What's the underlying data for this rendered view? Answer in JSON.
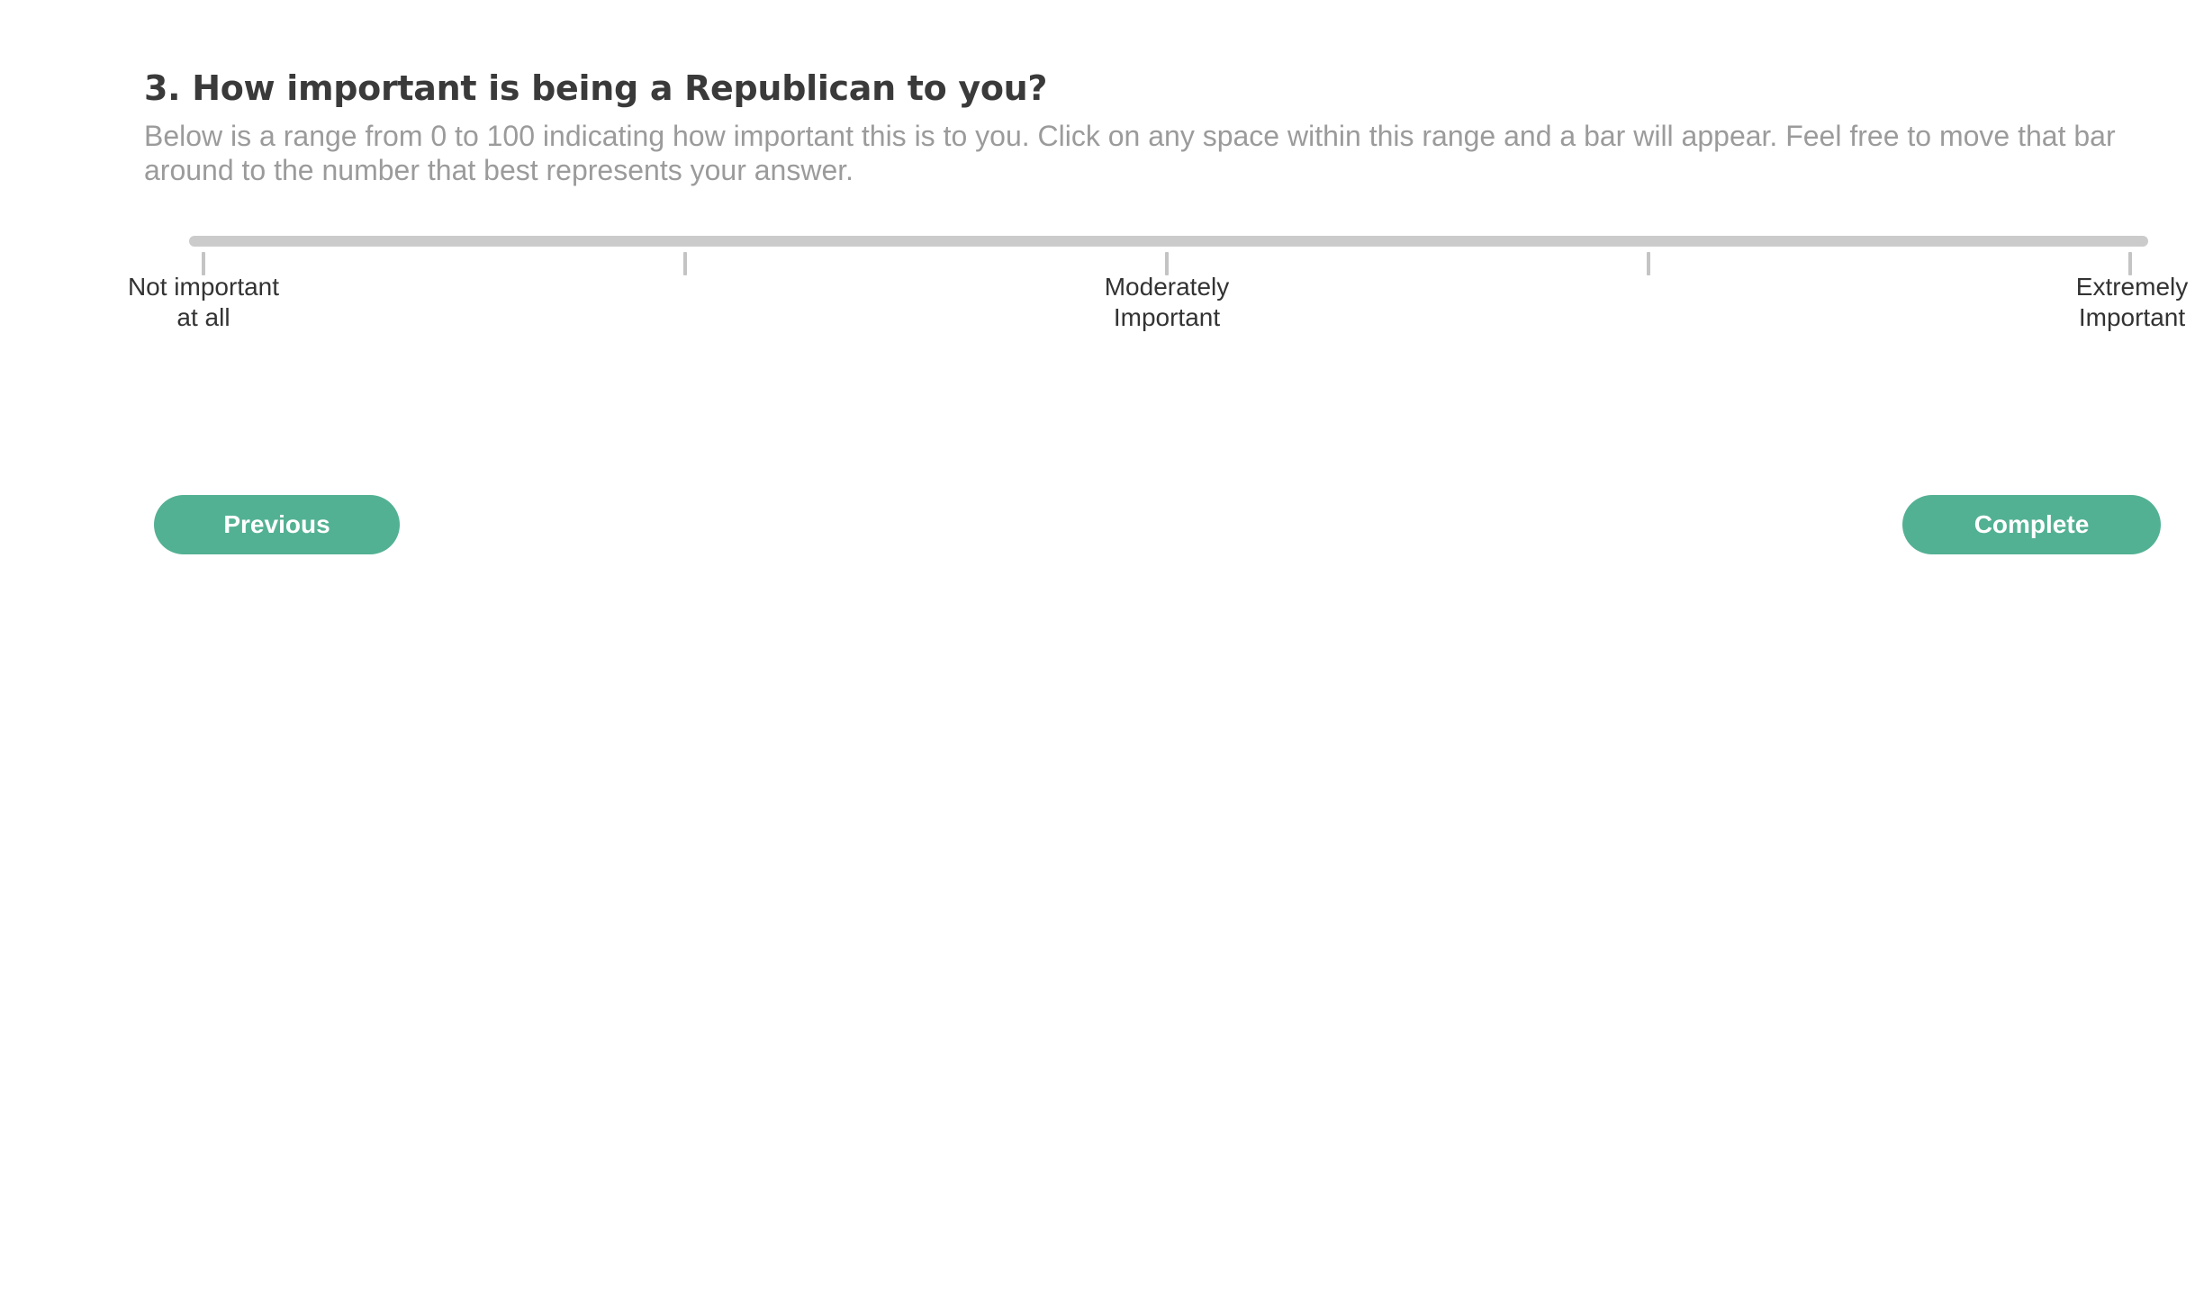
{
  "question": {
    "title": "3. How important is being a Republican to you?",
    "description": "Below is a range from 0 to 100 indicating how important this is to you. Click on any space within this range and a bar will appear. Feel free to move that bar around to the number that best represents your answer."
  },
  "slider": {
    "min": 0,
    "max": 100,
    "selected_value": null,
    "track_color": "#cbcbcb",
    "tick_color": "#c4c4c4",
    "ticks": [
      {
        "value": 0,
        "label": "Not important\nat all"
      },
      {
        "value": 25,
        "label": ""
      },
      {
        "value": 50,
        "label": "Moderately\nImportant"
      },
      {
        "value": 75,
        "label": ""
      },
      {
        "value": 100,
        "label": "Extremely\nImportant"
      }
    ]
  },
  "navigation": {
    "previous_label": "Previous",
    "complete_label": "Complete",
    "button_color": "#53b193"
  }
}
